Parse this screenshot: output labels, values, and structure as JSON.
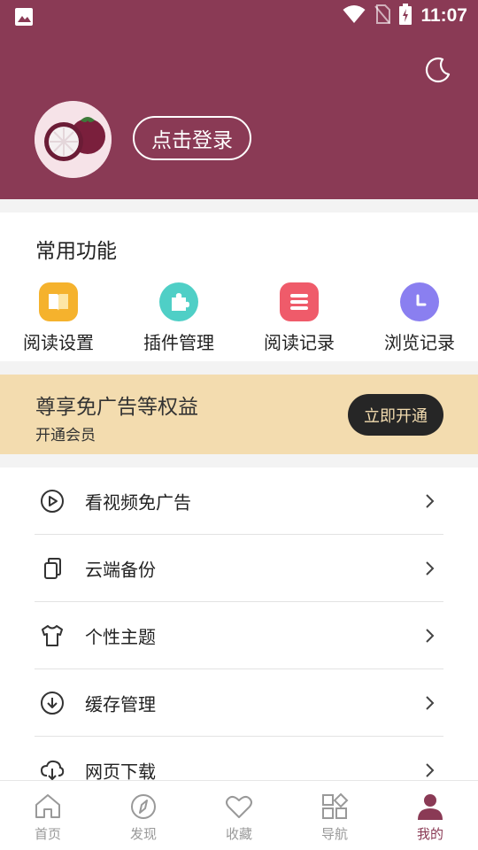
{
  "status_bar": {
    "time": "11:07"
  },
  "header": {
    "login_label": "点击登录"
  },
  "common_functions": {
    "title": "常用功能",
    "items": [
      {
        "label": "阅读设置",
        "icon": "book-icon",
        "color": "#f5b22d"
      },
      {
        "label": "插件管理",
        "icon": "puzzle-icon",
        "color": "#4fcfc6"
      },
      {
        "label": "阅读记录",
        "icon": "list-icon",
        "color": "#ef5b6a"
      },
      {
        "label": "浏览记录",
        "icon": "clock-icon",
        "color": "#8a7ff0"
      }
    ]
  },
  "vip_banner": {
    "title": "尊享免广告等权益",
    "subtitle": "开通会员",
    "button": "立即开通"
  },
  "menu": [
    {
      "label": "看视频免广告",
      "icon": "play-circle-icon"
    },
    {
      "label": "云端备份",
      "icon": "copy-icon"
    },
    {
      "label": "个性主题",
      "icon": "tshirt-icon"
    },
    {
      "label": "缓存管理",
      "icon": "download-circle-icon"
    },
    {
      "label": "网页下载",
      "icon": "cloud-download-icon"
    }
  ],
  "bottom_nav": [
    {
      "label": "首页",
      "icon": "home-icon"
    },
    {
      "label": "发现",
      "icon": "compass-icon"
    },
    {
      "label": "收藏",
      "icon": "heart-icon"
    },
    {
      "label": "导航",
      "icon": "grid-icon"
    },
    {
      "label": "我的",
      "icon": "person-icon",
      "active": true
    }
  ],
  "colors": {
    "brand": "#8a3a55",
    "vip_bg": "#f3dcaf",
    "vip_button": "#262626"
  }
}
